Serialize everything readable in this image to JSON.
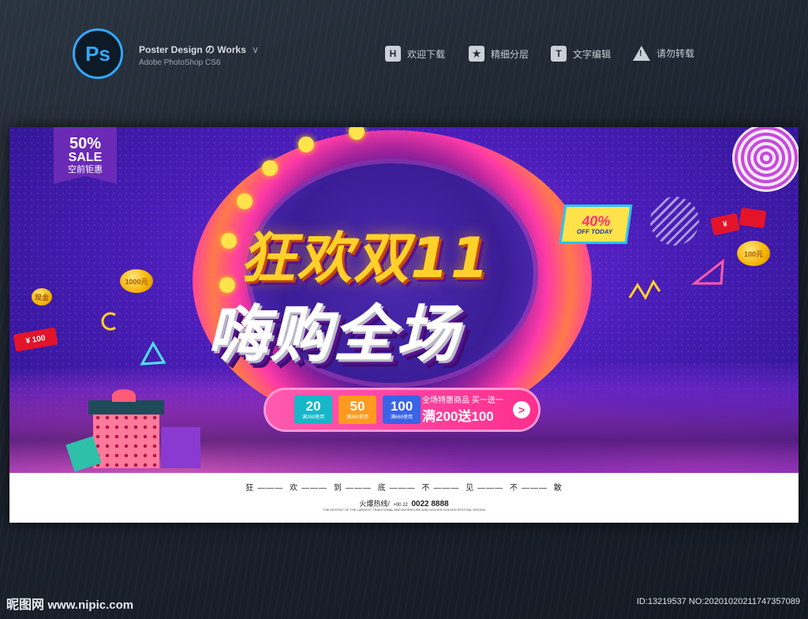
{
  "header": {
    "app_icon_text": "Ps",
    "brand_title": "Poster Design",
    "brand_suffix": "の",
    "brand_works": "Works",
    "brand_chevron": "∨",
    "brand_subtitle": "Adobe PhotoShop CS6",
    "nav": [
      {
        "icon": "H",
        "icon_name": "h-box-icon",
        "label": "欢迎下载"
      },
      {
        "icon": "★",
        "icon_name": "star-icon",
        "label": "精细分层"
      },
      {
        "icon": "T",
        "icon_name": "text-t-icon",
        "label": "文字编辑"
      },
      {
        "icon": "!",
        "icon_name": "warning-icon",
        "label": "请勿转载"
      }
    ]
  },
  "poster": {
    "badge": {
      "line1": "50%",
      "line2": "SALE",
      "line3": "空前钜惠"
    },
    "title_line1": "狂欢双11",
    "title_line2": "嗨购全场",
    "tag40": {
      "pct": "40%",
      "sub": "OFF TODAY"
    },
    "coupons": [
      {
        "value": "20",
        "note": "满269使用",
        "color": "#16b7c8"
      },
      {
        "value": "50",
        "note": "满360使用",
        "color": "#ff9a1f"
      },
      {
        "value": "100",
        "note": "满669使用",
        "color": "#3a63e6"
      }
    ],
    "promo_line1": "全场特惠商品 买一送一",
    "promo_line2": "满200送100",
    "promo_arrow": ">",
    "coin_labels": [
      "1000元",
      "100元",
      "¥100"
    ],
    "redtag_labels": [
      "¥ 100",
      "现金",
      "¥"
    ],
    "slogan": [
      "狂",
      "欢",
      "到",
      "底",
      "不",
      "见",
      "不",
      "散"
    ],
    "hotline_label": "火爆热线/",
    "hotline_prefix": "+00 22",
    "hotline_number": "0022 8888",
    "fine_print": "THE DESTINY OF THE LARGEST TRADITIONAL AND ADVENTURE AND GOLDEN GOLDEN FESTIVAL DESIGN"
  },
  "watermark": {
    "left_cn": "昵图网",
    "left_url": "www.nipic.com",
    "right": "ID:13219537 NO:20201020211747357089"
  },
  "colors": {
    "accent_ps": "#31a8ff",
    "title_gold": "#ffd12a",
    "promo_pink": "#ff2e8e"
  }
}
